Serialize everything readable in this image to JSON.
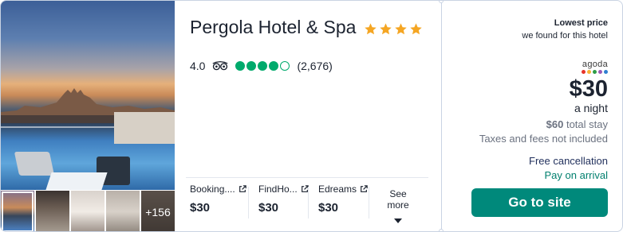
{
  "hotel": {
    "name": "Pergola Hotel & Spa",
    "stars": 4,
    "rating": "4.0",
    "bubbles_filled": 4,
    "bubbles_total": 5,
    "review_count": "(2,676)"
  },
  "photos": {
    "more_count": "+156"
  },
  "providers": [
    {
      "name": "Booking....",
      "price": "$30"
    },
    {
      "name": "FindHo...",
      "price": "$30"
    },
    {
      "name": "Edreams",
      "price": "$30"
    }
  ],
  "see_more": {
    "label": "See more"
  },
  "deal": {
    "lowest_title": "Lowest price",
    "lowest_sub": "we found for this hotel",
    "provider_logo_text": "agoda",
    "price": "$30",
    "per_night": "a night",
    "total_amount": "$60",
    "total_label": "total stay",
    "taxes": "Taxes and fees not included",
    "free_cancellation": "Free cancellation",
    "pay_on_arrival": "Pay on arrival",
    "cta": "Go to site"
  },
  "colors": {
    "star": "#f5a623",
    "bubble": "#00aa6c",
    "cta": "#00897b",
    "pay_on_arrival": "#007f6e",
    "agoda_dots": [
      "#e6332a",
      "#f9b233",
      "#2e9c46",
      "#9b59b6",
      "#2f7fd1"
    ]
  }
}
